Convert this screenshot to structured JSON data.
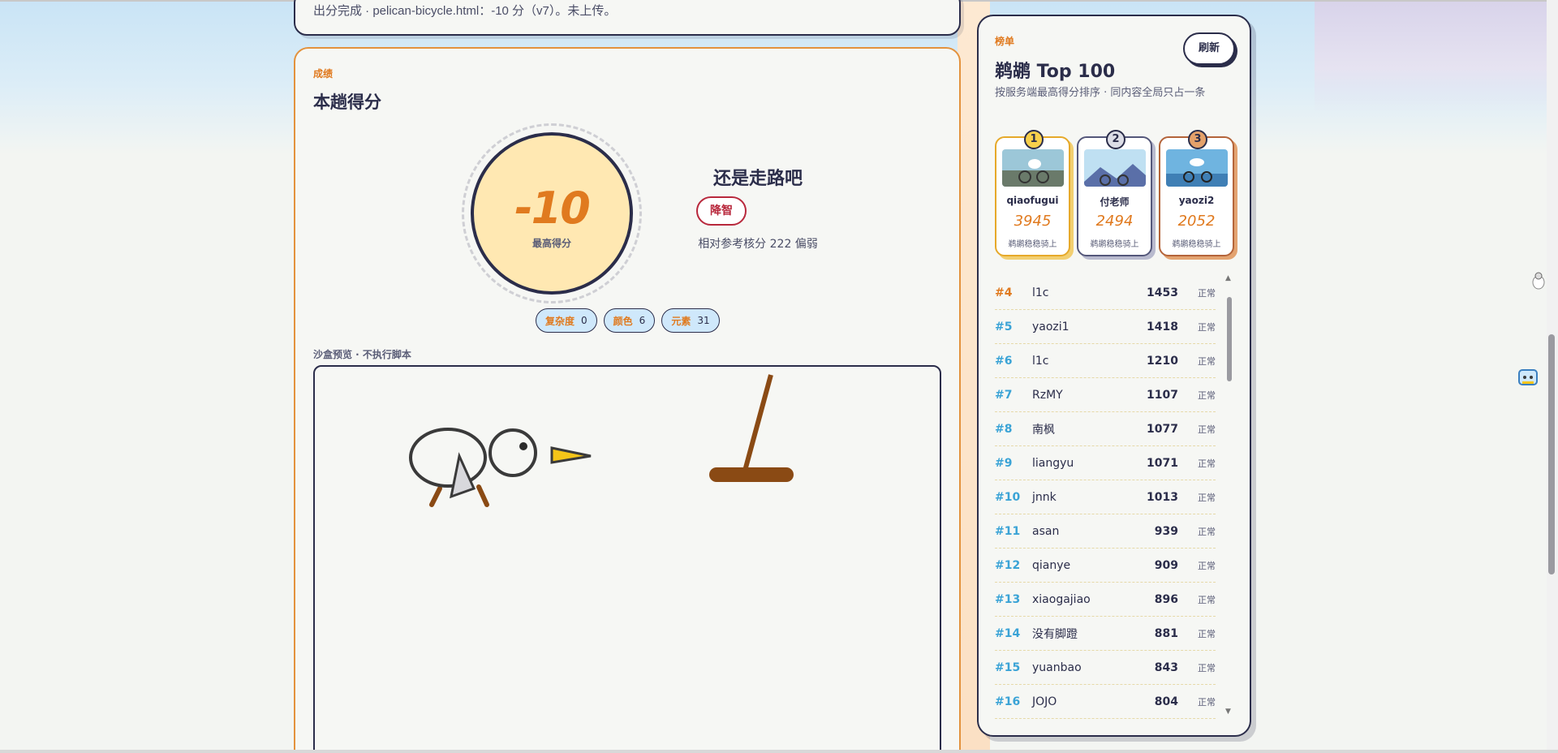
{
  "top_card": {
    "message": "出分完成 · pelican-bicycle.html：-10 分（v7）。未上传。"
  },
  "score_section": {
    "eyebrow": "成绩",
    "title": "本趟得分",
    "score": "-10",
    "score_label": "最高得分",
    "verdict": "还是走路吧",
    "badge": "降智",
    "relative_text": "相对参考核分 222 偏弱",
    "chips": [
      {
        "key": "复杂度",
        "value": "0"
      },
      {
        "key": "颜色",
        "value": "6"
      },
      {
        "key": "元素",
        "value": "31"
      }
    ],
    "sandbox_label": "沙盒预览 · 不执行脚本"
  },
  "leaderboard": {
    "eyebrow": "榜单",
    "title": "鹈鹕 Top 100",
    "subtitle": "按服务端最高得分排序 · 同内容全局只占一条",
    "refresh_label": "刷新",
    "podium": [
      {
        "rank": "1",
        "name": "qiaofugui",
        "score": "3945",
        "caption": "鹈鹕稳稳骑上"
      },
      {
        "rank": "2",
        "name": "付老师",
        "score": "2494",
        "caption": "鹈鹕稳稳骑上"
      },
      {
        "rank": "3",
        "name": "yaozi2",
        "score": "2052",
        "caption": "鹈鹕稳稳骑上"
      }
    ],
    "rows": [
      {
        "rank": "#4",
        "name": "l1c",
        "score": "1453",
        "status": "正常"
      },
      {
        "rank": "#5",
        "name": "yaozi1",
        "score": "1418",
        "status": "正常"
      },
      {
        "rank": "#6",
        "name": "l1c",
        "score": "1210",
        "status": "正常"
      },
      {
        "rank": "#7",
        "name": "RzMY",
        "score": "1107",
        "status": "正常"
      },
      {
        "rank": "#8",
        "name": "南枫",
        "score": "1077",
        "status": "正常"
      },
      {
        "rank": "#9",
        "name": "liangyu",
        "score": "1071",
        "status": "正常"
      },
      {
        "rank": "#10",
        "name": "jnnk",
        "score": "1013",
        "status": "正常"
      },
      {
        "rank": "#11",
        "name": "asan",
        "score": "939",
        "status": "正常"
      },
      {
        "rank": "#12",
        "name": "qianye",
        "score": "909",
        "status": "正常"
      },
      {
        "rank": "#13",
        "name": "xiaogajiao",
        "score": "896",
        "status": "正常"
      },
      {
        "rank": "#14",
        "name": "没有脚蹬",
        "score": "881",
        "status": "正常"
      },
      {
        "rank": "#15",
        "name": "yuanbao",
        "score": "843",
        "status": "正常"
      },
      {
        "rank": "#16",
        "name": "JOJO",
        "score": "804",
        "status": "正常"
      }
    ]
  },
  "colors": {
    "accent": "#e07a1f",
    "ink": "#2b2d4a",
    "gold": "#f7cf4b",
    "rank_blue": "#3aa3d6",
    "danger": "#b8283c",
    "score_fill": "#ffe8b2"
  }
}
